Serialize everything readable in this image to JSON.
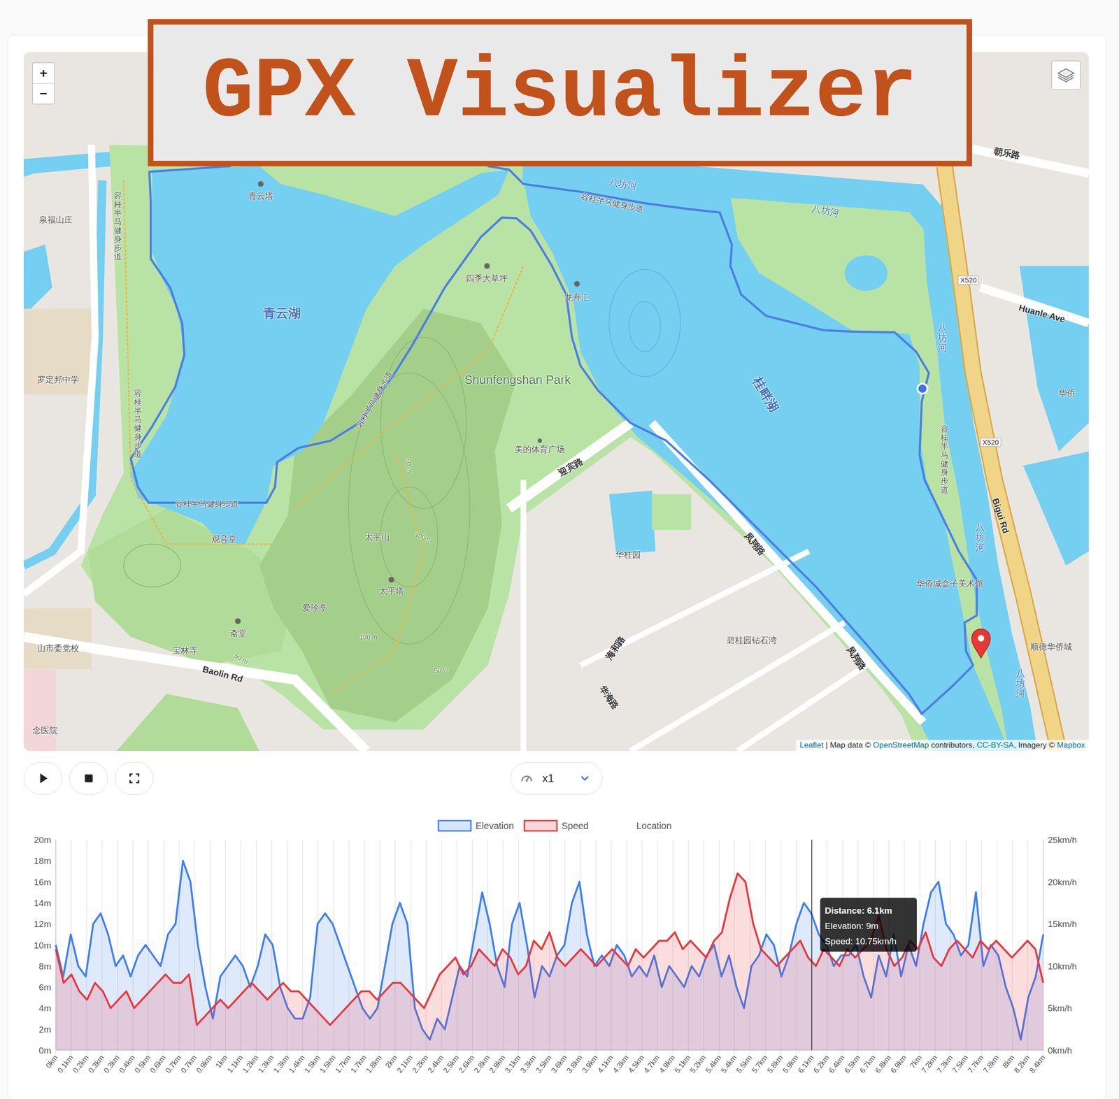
{
  "banner": {
    "title": "GPX Visualizer"
  },
  "map": {
    "zoom_in": "+",
    "zoom_out": "−",
    "labels": [
      {
        "text": "青云湖",
        "kind": "lake"
      },
      {
        "text": "八坊河",
        "kind": "river"
      },
      {
        "text": "八坊河",
        "kind": "river"
      },
      {
        "text": "八坊河",
        "kind": "river_v"
      },
      {
        "text": "八坊河",
        "kind": "river_v"
      },
      {
        "text": "八坊河",
        "kind": "river_v"
      },
      {
        "text": "桂畔湖",
        "kind": "lake"
      },
      {
        "text": "Shunfengshan Park",
        "kind": "park"
      },
      {
        "text": "四季大草坪",
        "kind": "poi"
      },
      {
        "text": "龙舟汇",
        "kind": "poi"
      },
      {
        "text": "青云塔",
        "kind": "poi"
      },
      {
        "text": "美的体育广场",
        "kind": "poi"
      },
      {
        "text": "迎宾路",
        "kind": "road"
      },
      {
        "text": "太平山",
        "kind": "poi"
      },
      {
        "text": "太平塔",
        "kind": "poi"
      },
      {
        "text": "爱珍亭",
        "kind": "poi"
      },
      {
        "text": "观音堂",
        "kind": "poi"
      },
      {
        "text": "斋堂",
        "kind": "poi"
      },
      {
        "text": "宝林寺",
        "kind": "poi"
      },
      {
        "text": "Baolin Rd",
        "kind": "road"
      },
      {
        "text": "华桂园",
        "kind": "poi"
      },
      {
        "text": "碧桂园钻石湾",
        "kind": "poi"
      },
      {
        "text": "海和路",
        "kind": "road"
      },
      {
        "text": "华海路",
        "kind": "road"
      },
      {
        "text": "朝乐路",
        "kind": "road"
      },
      {
        "text": "Huanle Ave",
        "kind": "road"
      },
      {
        "text": "X520",
        "kind": "shield"
      },
      {
        "text": "X520",
        "kind": "shield"
      },
      {
        "text": "Bigui Rd",
        "kind": "road"
      },
      {
        "text": "华侨城盒子美术馆",
        "kind": "poi"
      },
      {
        "text": "顺德华侨城",
        "kind": "poi"
      },
      {
        "text": "华侨",
        "kind": "poi"
      },
      {
        "text": "罗定邦中学",
        "kind": "poi"
      },
      {
        "text": "泉福山庄",
        "kind": "poi"
      },
      {
        "text": "容桂半马健身步道",
        "kind": "trail_v"
      },
      {
        "text": "容桂半马健身步道",
        "kind": "trail_v"
      },
      {
        "text": "容桂半马健身步道",
        "kind": "trail"
      },
      {
        "text": "容桂半马健身步道",
        "kind": "trail"
      },
      {
        "text": "容桂半马健身步道",
        "kind": "trail"
      },
      {
        "text": "容桂半马健身步道",
        "kind": "trail_v"
      },
      {
        "text": "凤翔路",
        "kind": "road"
      },
      {
        "text": "凤翔路",
        "kind": "road"
      },
      {
        "text": "山市委党校",
        "kind": "poi"
      },
      {
        "text": "念医院",
        "kind": "poi"
      },
      {
        "text": "50 m",
        "kind": "contour"
      },
      {
        "text": "100 m",
        "kind": "contour"
      },
      {
        "text": "100 m",
        "kind": "contour"
      },
      {
        "text": "50 m",
        "kind": "contour"
      },
      {
        "text": "50 m",
        "kind": "contour"
      }
    ],
    "attribution": [
      {
        "text": "Leaflet",
        "link": true
      },
      {
        "text": " | Map data © ",
        "link": false
      },
      {
        "text": "OpenStreetMap",
        "link": true
      },
      {
        "text": " contributors, ",
        "link": false
      },
      {
        "text": "CC-BY-SA",
        "link": true
      },
      {
        "text": ", Imagery © ",
        "link": false
      },
      {
        "text": "Mapbox",
        "link": true
      }
    ]
  },
  "player": {
    "speed": "x1"
  },
  "chart": {
    "series": [
      {
        "label": "Elevation",
        "color": "#3f7ff0",
        "axis": "left",
        "values": [
          10,
          7,
          11,
          8,
          7,
          12,
          13,
          11,
          8,
          9,
          7,
          9,
          10,
          9,
          8,
          11,
          12,
          18,
          16,
          10,
          6,
          3,
          7,
          8,
          9,
          8,
          6,
          8,
          11,
          10,
          6,
          4,
          3,
          3,
          5,
          12,
          13,
          12,
          10,
          8,
          6,
          4,
          3,
          4,
          8,
          12,
          14,
          12,
          4,
          2,
          1,
          3,
          2,
          5,
          8,
          7,
          11,
          15,
          12,
          8,
          6,
          12,
          14,
          10,
          5,
          8,
          7,
          9,
          10,
          14,
          16,
          11,
          8,
          9,
          8,
          10,
          9,
          7,
          8,
          7,
          9,
          6,
          8,
          7,
          6,
          8,
          7,
          9,
          10,
          7,
          9,
          6,
          4,
          8,
          9,
          11,
          10,
          7,
          9,
          12,
          14,
          13,
          11,
          10,
          8,
          9,
          9,
          10,
          7,
          5,
          9,
          7,
          11,
          7,
          10,
          8,
          12,
          15,
          16,
          12,
          11,
          9,
          10,
          15,
          8,
          10,
          9,
          6,
          4,
          1,
          5,
          7,
          11
        ]
      },
      {
        "label": "Speed",
        "color": "#e8383d",
        "axis": "right",
        "values": [
          12,
          8,
          9,
          7,
          6,
          8,
          7,
          5,
          6,
          7,
          5,
          6,
          7,
          8,
          9,
          8,
          8,
          9,
          3,
          4,
          5,
          6,
          5,
          6,
          7,
          8,
          7,
          6,
          7,
          8,
          7,
          7,
          6,
          5,
          4,
          3,
          4,
          5,
          6,
          7,
          7,
          6,
          7,
          8,
          8,
          7,
          6,
          5,
          7,
          9,
          10,
          11,
          9,
          10,
          12,
          11,
          10,
          12,
          11,
          9,
          10,
          13,
          12,
          14,
          11,
          10,
          11,
          12,
          11,
          10,
          11,
          12,
          11,
          10,
          12,
          11,
          12,
          13,
          13,
          14,
          12,
          13,
          12,
          11,
          13,
          14,
          18,
          21,
          20,
          15,
          12,
          11,
          10,
          11,
          12,
          13,
          11,
          10,
          12,
          11,
          10,
          12,
          11,
          12,
          13,
          16,
          12,
          10,
          11,
          13,
          12,
          14,
          11,
          10,
          12,
          13,
          12,
          11,
          13,
          12,
          13,
          12,
          11,
          12,
          13,
          12,
          8
        ]
      }
    ],
    "legend_extra": "Location",
    "y_left_ticks": [
      "0m",
      "2m",
      "4m",
      "6m",
      "8m",
      "10m",
      "12m",
      "14m",
      "16m",
      "18m",
      "20m"
    ],
    "y_right_ticks": [
      "0km/h",
      "5km/h",
      "10km/h",
      "15km/h",
      "20km/h",
      "25km/h"
    ],
    "x_ticks": [
      "0km",
      "0.1km",
      "0.2km",
      "0.3km",
      "0.3km",
      "0.4km",
      "0.5km",
      "0.6km",
      "0.7km",
      "0.7km",
      "0.9km",
      "1km",
      "1.1km",
      "1.2km",
      "1.3km",
      "1.3km",
      "1.4km",
      "1.5km",
      "1.5km",
      "1.7km",
      "1.7km",
      "1.8km",
      "2km",
      "2.1km",
      "2.2km",
      "2.4km",
      "2.5km",
      "2.6km",
      "2.8km",
      "2.9km",
      "3.1km",
      "3.3km",
      "3.5km",
      "3.6km",
      "3.8km",
      "3.9km",
      "4.1km",
      "4.3km",
      "4.5km",
      "4.7km",
      "4.9km",
      "5.1km",
      "5.2km",
      "5.4km",
      "5.4km",
      "5.5km",
      "5.7km",
      "5.8km",
      "5.9km",
      "6.1km",
      "6.2km",
      "6.4km",
      "6.5km",
      "6.7km",
      "6.8km",
      "6.9km",
      "7km",
      "7.2km",
      "7.3km",
      "7.5km",
      "7.7km",
      "7.8km",
      "8km",
      "8.2km",
      "8.4km"
    ],
    "hover_index": 49,
    "tooltip": [
      "Distance: 6.1km",
      "Elevation: 9m",
      "Speed: 10.75km/h"
    ]
  }
}
